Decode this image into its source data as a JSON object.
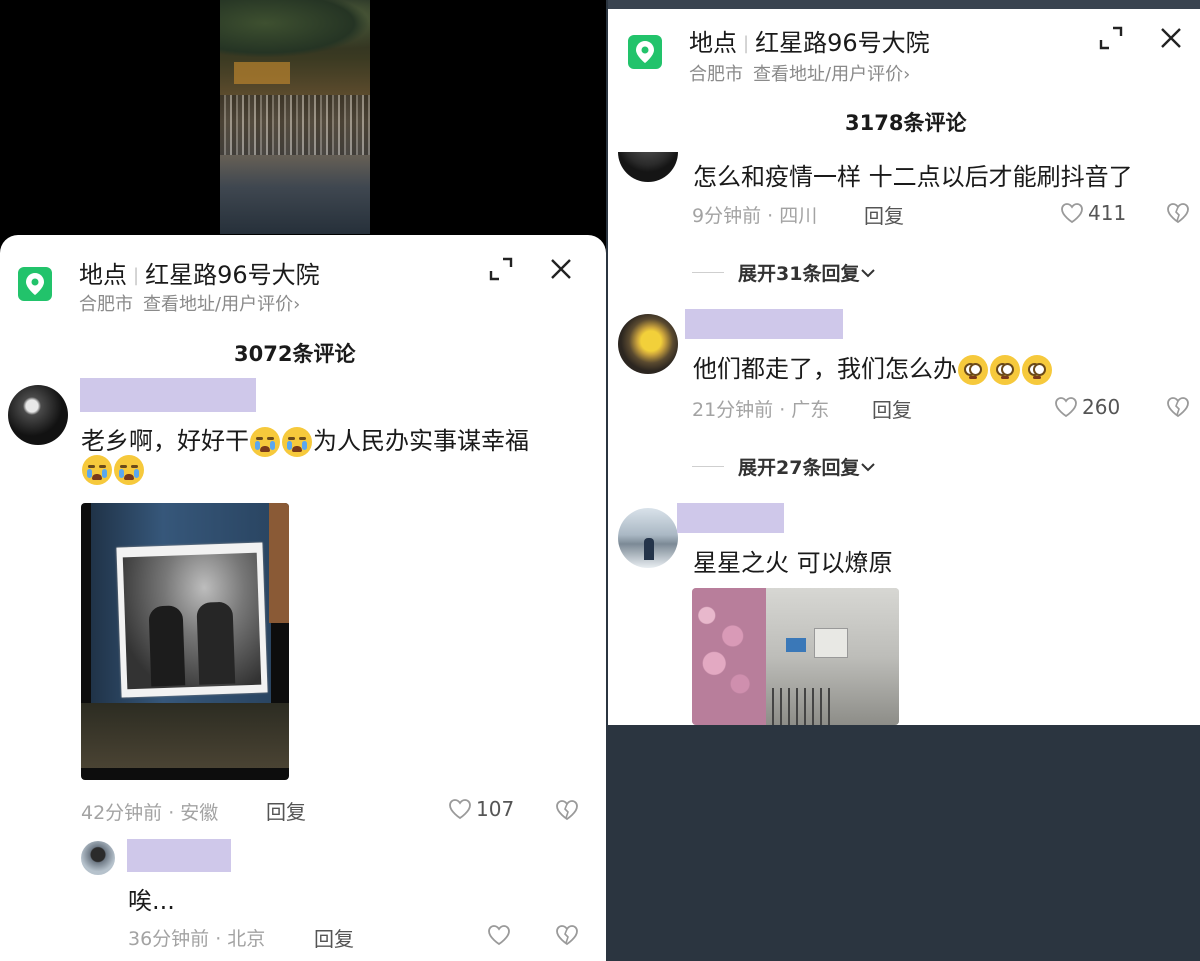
{
  "left": {
    "location": {
      "label": "地点",
      "name": "红星路96号大院",
      "city": "合肥市",
      "link": "查看地址/用户评价",
      "chevron": "›"
    },
    "comment_count": "3072条评论",
    "comments": [
      {
        "text_line1_a": "老乡啊，好好干",
        "text_line1_b": "为人民办实事谋幸福",
        "meta": "42分钟前 · 安徽",
        "reply": "回复",
        "likes": "107"
      },
      {
        "text": "唉...",
        "meta": "36分钟前 · 北京",
        "reply": "回复",
        "likes": ""
      }
    ]
  },
  "right": {
    "location": {
      "label": "地点",
      "name": "红星路96号大院",
      "city": "合肥市",
      "link": "查看地址/用户评价",
      "chevron": "›"
    },
    "comment_count": "3178条评论",
    "comments": [
      {
        "text": "怎么和疫情一样 十二点以后才能刷抖音了",
        "meta": "9分钟前 · 四川",
        "reply": "回复",
        "likes": "411",
        "expand": "展开31条回复"
      },
      {
        "text": "他们都走了，我们怎么办",
        "meta": "21分钟前 · 广东",
        "reply": "回复",
        "likes": "260",
        "expand": "展开27条回复"
      },
      {
        "text": "星星之火 可以燎原"
      }
    ]
  },
  "colors": {
    "accent_green": "#22c36b",
    "name_redaction": "#cfc8ea",
    "meta_gray": "#a3a3a3"
  },
  "icons": [
    "location-pin-icon",
    "expand-icon",
    "close-icon",
    "heart-icon",
    "broken-heart-icon",
    "chevron-down-icon",
    "crying-emoji-icon",
    "pleading-emoji-icon"
  ]
}
